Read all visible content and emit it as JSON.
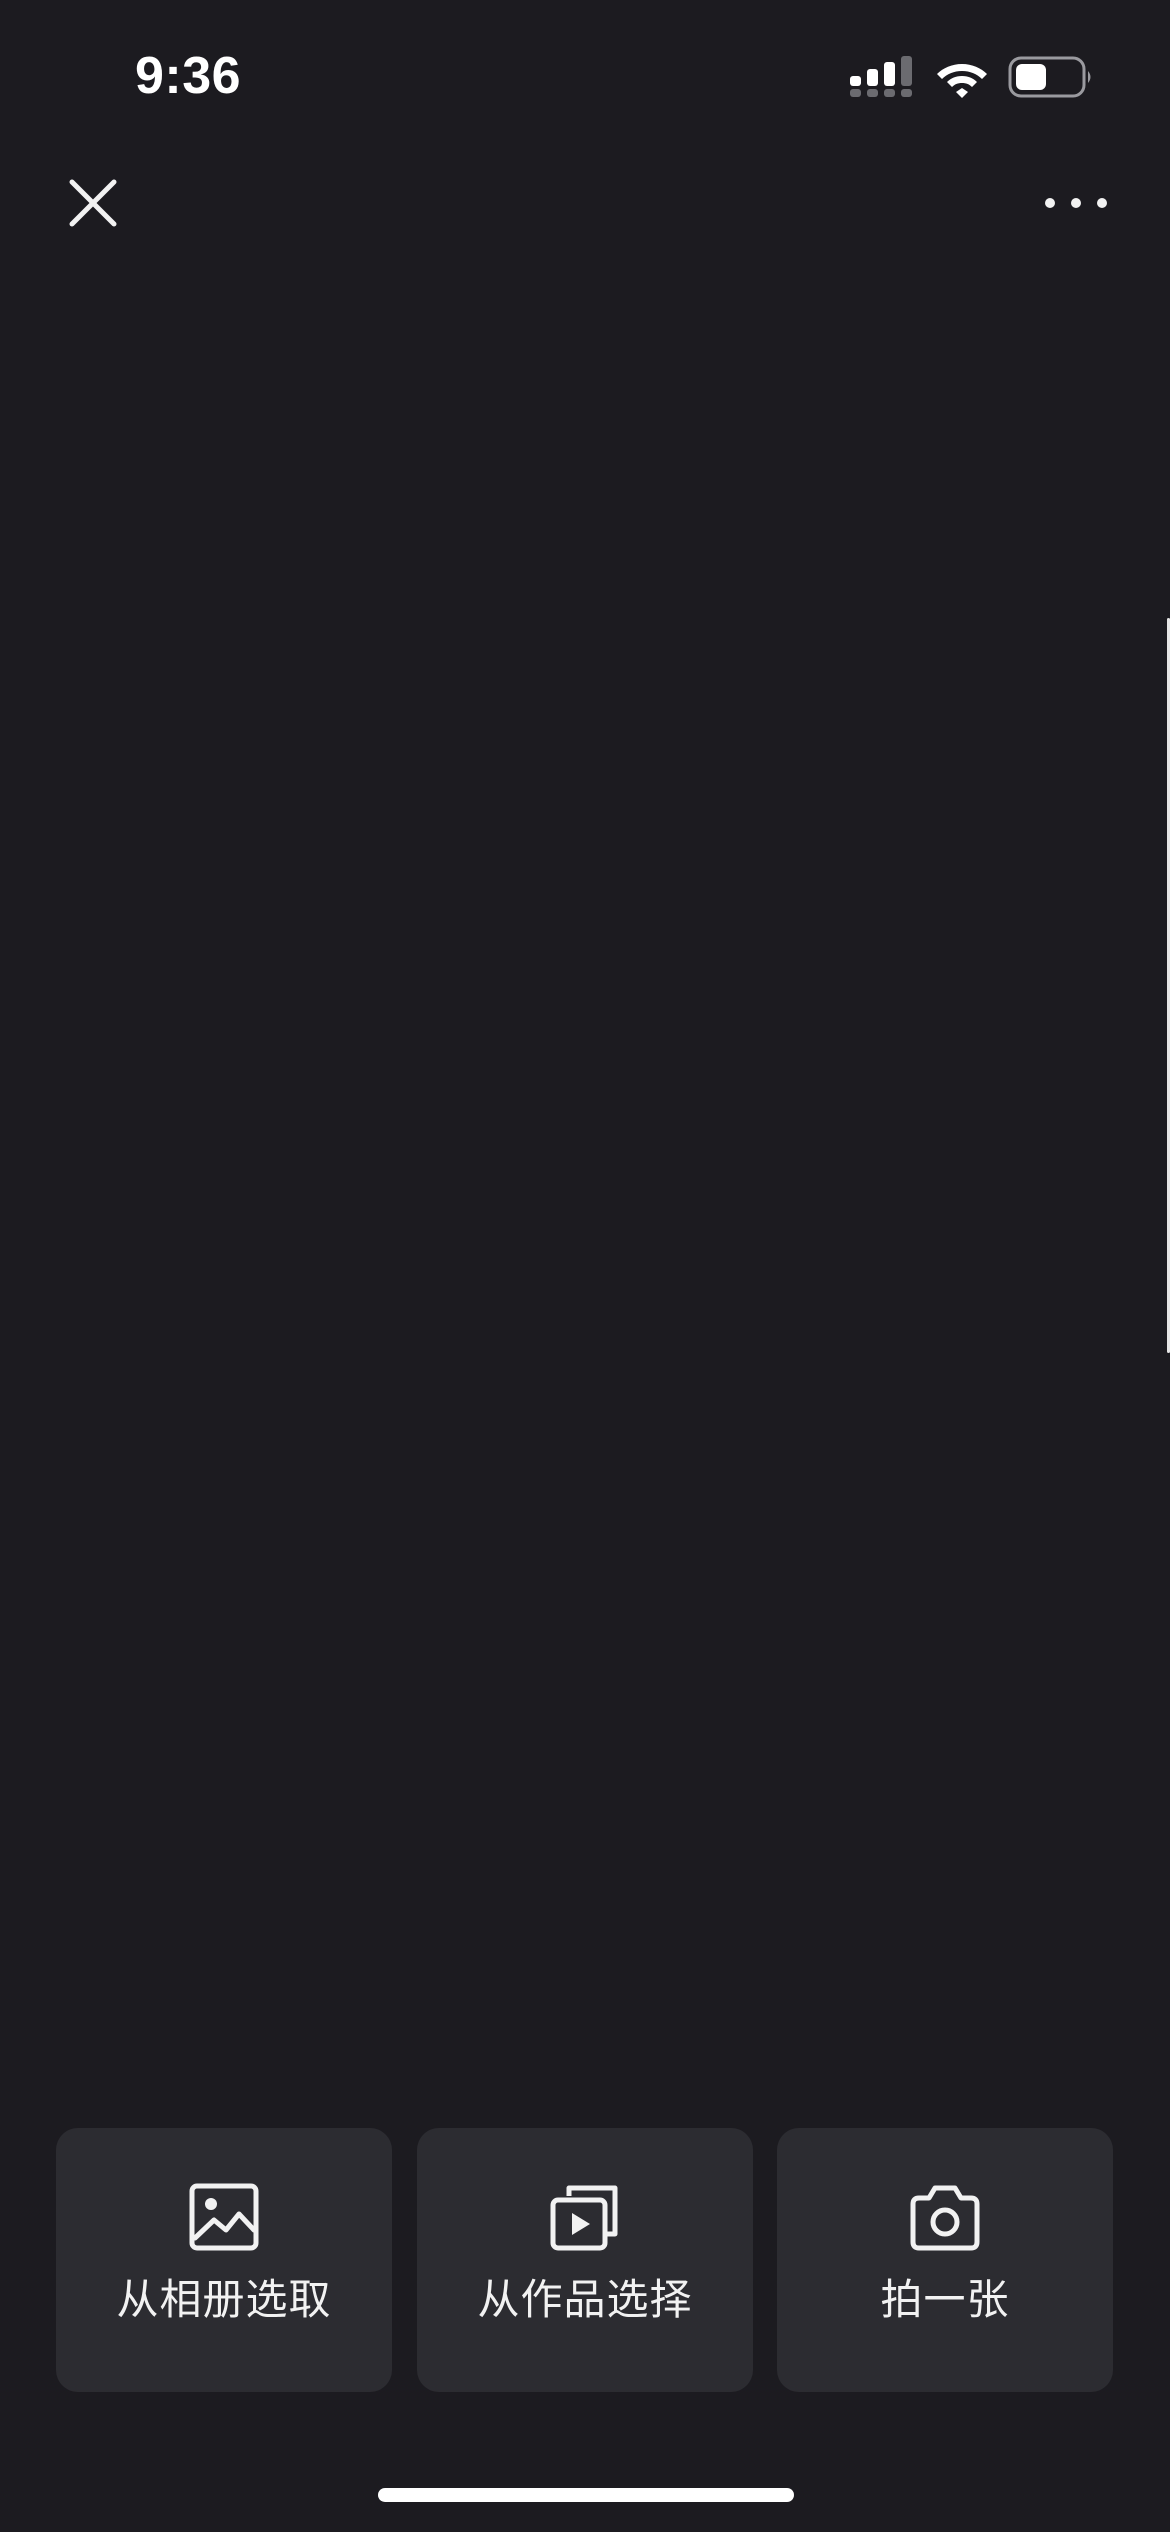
{
  "status_bar": {
    "time": "9:36",
    "cellular_icon": "cellular-signal-icon",
    "wifi_icon": "wifi-icon",
    "battery_icon": "battery-icon"
  },
  "nav": {
    "close_icon": "close-icon",
    "more_icon": "more-horizontal-icon"
  },
  "actions": [
    {
      "label": "从相册选取",
      "icon": "image-icon"
    },
    {
      "label": "从作品选择",
      "icon": "video-stack-icon"
    },
    {
      "label": "拍一张",
      "icon": "camera-icon"
    }
  ],
  "colors": {
    "background": "#1c1b20",
    "card": "#2c2c31",
    "text": "#f2f2f2"
  }
}
